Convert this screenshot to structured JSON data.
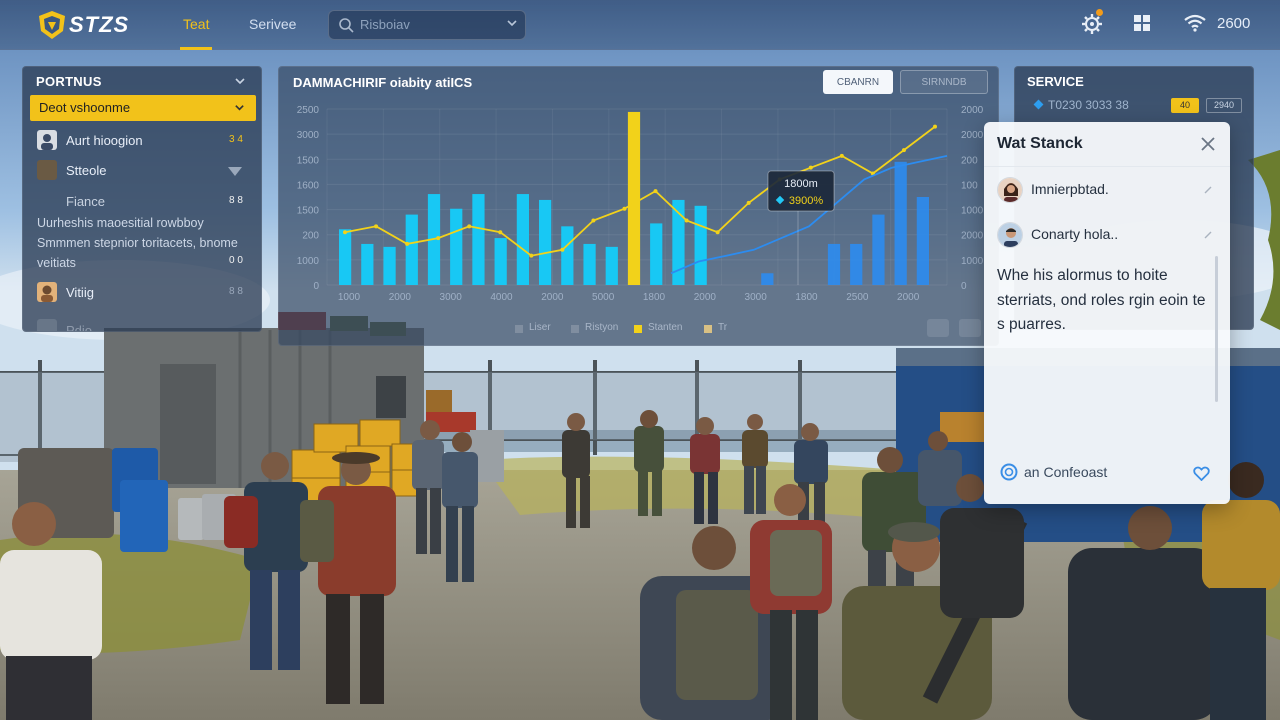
{
  "topbar": {
    "brand": "STZS",
    "tabs": [
      {
        "label": "Teat",
        "active": true
      },
      {
        "label": "Serivee",
        "active": false
      }
    ],
    "search_placeholder": "Risboiav",
    "status_value": "2600",
    "icons": [
      "gear-icon",
      "grid-icon",
      "wifi-icon"
    ]
  },
  "left_panel": {
    "title": "PORTNUS",
    "selected": "Deot vshoonme",
    "items": [
      {
        "label": "Aurt hioogion",
        "value": "3 4"
      },
      {
        "label": "Stteole",
        "value": ""
      },
      {
        "label": "Fiance",
        "value": "8 8"
      }
    ],
    "description": "Uurheshis maoesitial rowbboy Smmmen stepnior toritacets, bnome veitiats",
    "description_value": "0 0",
    "last_item": {
      "label": "Vitiig",
      "value": "8 8"
    },
    "faded_item": {
      "label": "Pdio"
    }
  },
  "chart_panel": {
    "title": "DAMMACHIRIF oiabity atiICS",
    "button_primary": "CBANRN",
    "button_secondary": "SIRNNDB",
    "tooltip": {
      "line1": "1800m",
      "line2": "3900%"
    },
    "legend": [
      "Liser",
      "Ristyon",
      "Stanten",
      "Tr"
    ]
  },
  "chart_data": {
    "type": "bar",
    "title": "DAMMACHIRIF oiabity atiICS",
    "ylim": [
      0,
      3000
    ],
    "y_ticks": [
      "2500",
      "3000",
      "1500",
      "1600",
      "1500",
      "200",
      "1000",
      "0"
    ],
    "y_ticks_right": [
      "2000",
      "2000",
      "200",
      "100",
      "1000",
      "2000",
      "1000",
      "0"
    ],
    "x_ticks": [
      "1000",
      "2000",
      "3000",
      "4000",
      "2000",
      "5000",
      "1800",
      "2000",
      "3000",
      "1800",
      "2500",
      "2000"
    ],
    "grid": true,
    "legend_position": "bottom",
    "colors": {
      "cyan": "#18c8f4",
      "yellow": "#f2d21a",
      "blue": "#2c8cf0"
    },
    "series": [
      {
        "values": [
          950,
          700,
          650,
          1200,
          1550,
          1300,
          1550,
          800,
          1550,
          1450,
          1000,
          700,
          650,
          2950,
          1050,
          1450,
          1350,
          0,
          0,
          200,
          0,
          0,
          700,
          700,
          1200,
          2100,
          1500
        ]
      },
      {
        "values": [
          900,
          1000,
          700,
          800,
          1000,
          900,
          500,
          600,
          1100,
          1300,
          1600,
          1100,
          900,
          1400,
          1800,
          2000,
          2200,
          1900,
          2300,
          2700
        ]
      },
      {
        "values": [
          200,
          400,
          500,
          600,
          800,
          1000,
          1400,
          1800,
          2000,
          2100,
          2200
        ]
      }
    ]
  },
  "service_panel": {
    "title": "SERVICE",
    "value": "T0230 3033 38",
    "badge1": "40",
    "badge2": "2940"
  },
  "popup": {
    "title": "Wat Stanck",
    "items": [
      {
        "label": "Imnierpbtad."
      },
      {
        "label": "Conarty hola.."
      }
    ],
    "body": "Whe his alormus to hoite sterriats, ond roles rgin eoin te s puarres.",
    "link": "an Confeoast"
  }
}
